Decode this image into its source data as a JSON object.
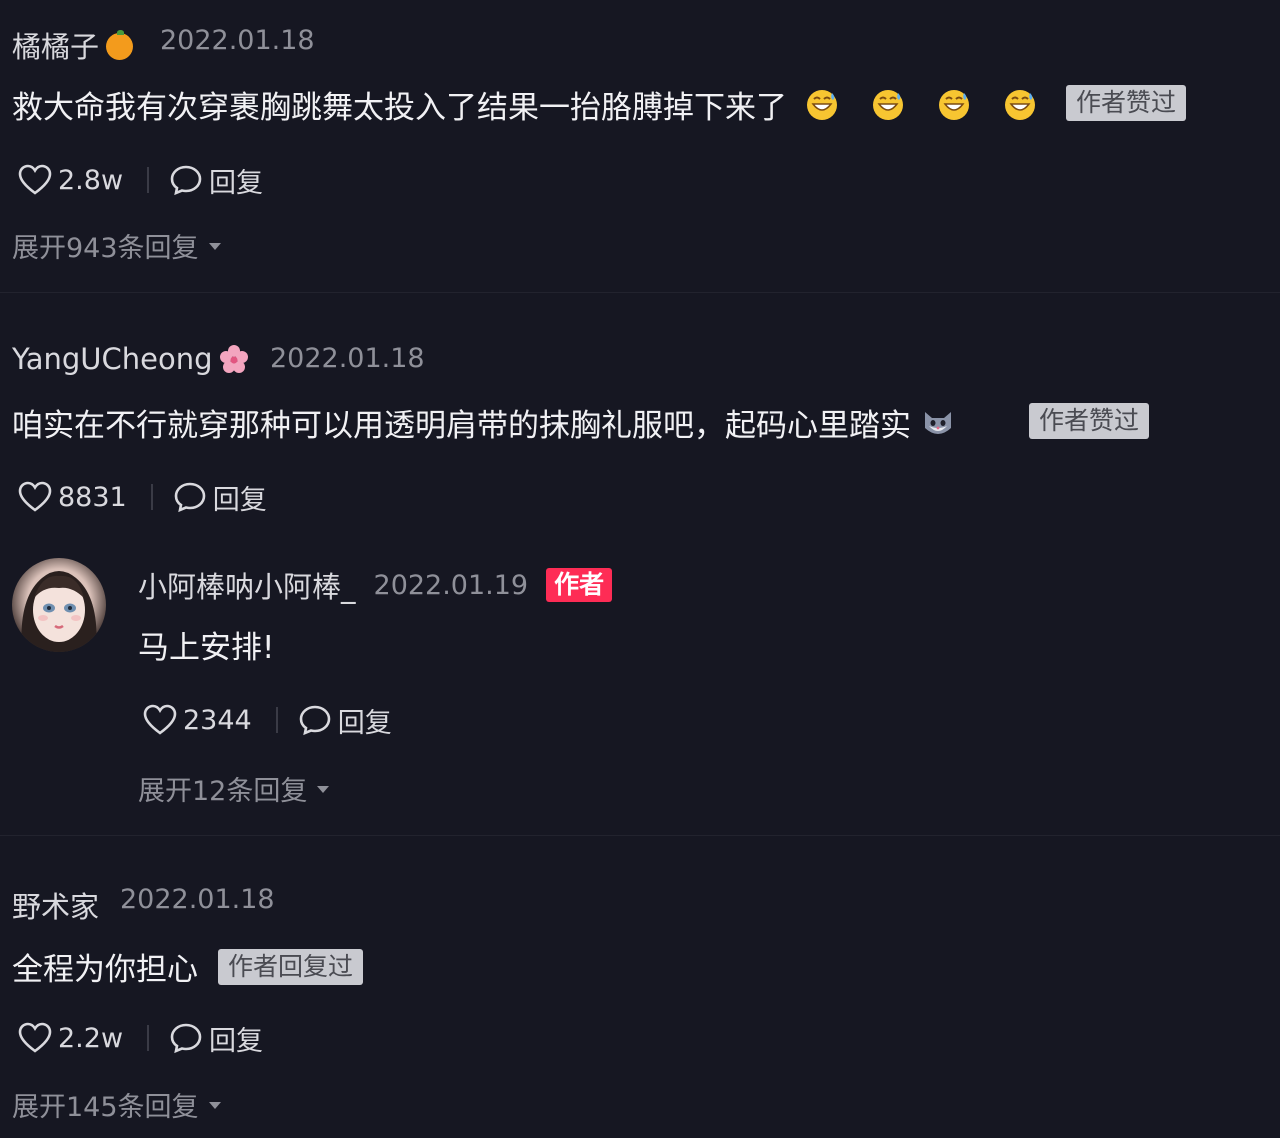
{
  "comments": [
    {
      "username": "橘橘子",
      "username_icon": "orange-emoji",
      "date": "2022.01.18",
      "text": "救大命我有次穿裹胸跳舞太投入了结果一抬胳膊掉下来了",
      "emojis": [
        "grinning-sweat-emoji",
        "grinning-sweat-emoji",
        "grinning-sweat-emoji",
        "grinning-sweat-emoji"
      ],
      "tag": "作者赞过",
      "likes": "2.8w",
      "reply_label": "回复",
      "expand": "展开943条回复"
    },
    {
      "username": "YangUCheong",
      "username_icon": "cherry-blossom-emoji",
      "date": "2022.01.18",
      "text": "咱实在不行就穿那种可以用透明肩带的抹胸礼服吧，起码心里踏实",
      "emojis": [
        "cat-face-emoji"
      ],
      "tag": "作者赞过",
      "likes": "8831",
      "reply_label": "回复",
      "reply": {
        "username": "小阿棒呐小阿棒_",
        "date": "2022.01.19",
        "author_badge": "作者",
        "text": "马上安排!",
        "likes": "2344",
        "reply_label": "回复",
        "expand": "展开12条回复"
      }
    },
    {
      "username": "野术家",
      "date": "2022.01.18",
      "text": "全程为你担心",
      "tag": "作者回复过",
      "likes": "2.2w",
      "reply_label": "回复",
      "expand": "展开145条回复"
    }
  ],
  "colors": {
    "background": "#161722",
    "author_badge": "#fe2c55",
    "tag_bg": "#c9cad0"
  }
}
